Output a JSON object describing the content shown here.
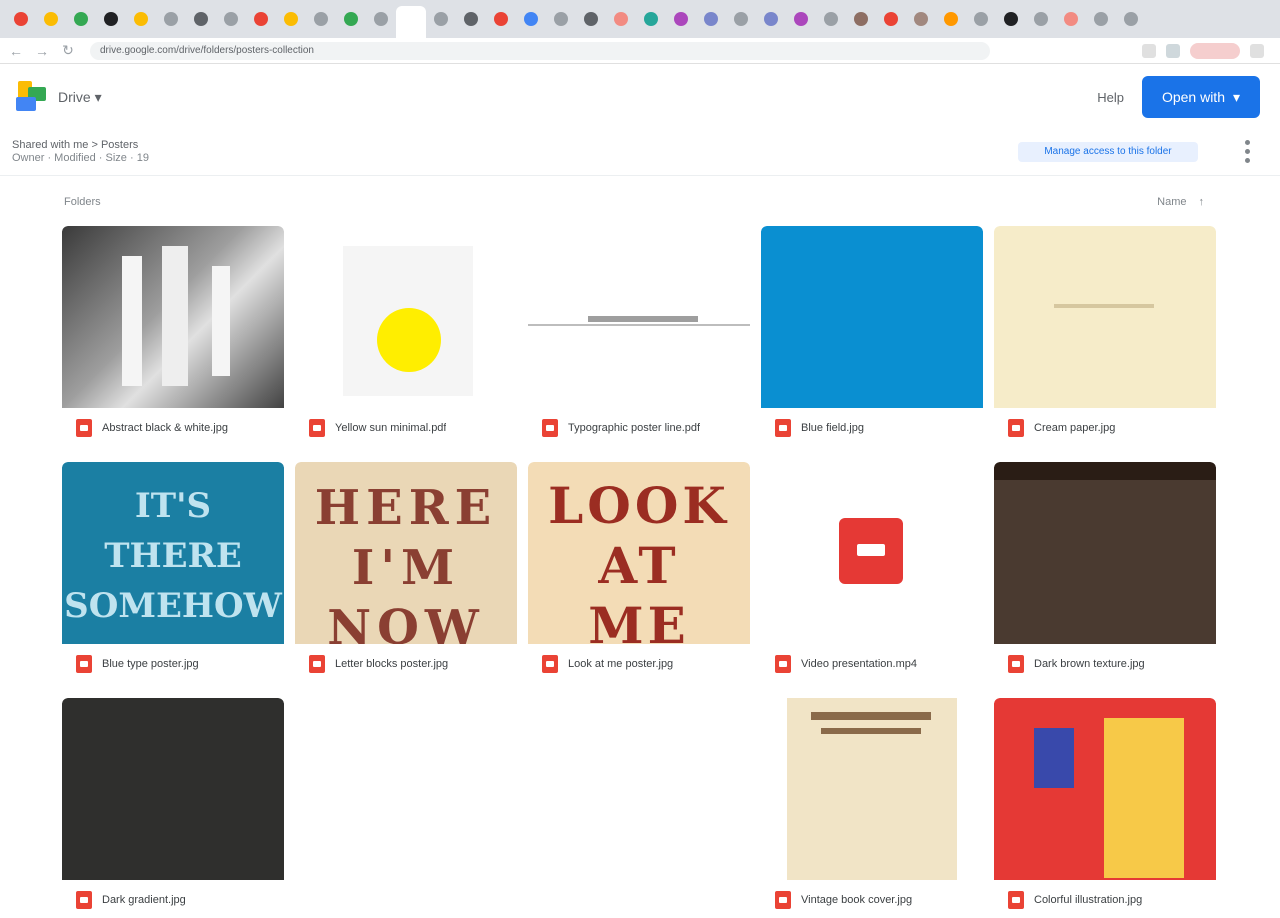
{
  "browser": {
    "tabs": [
      {
        "color": "#ea4335"
      },
      {
        "color": "#fbbc04"
      },
      {
        "color": "#34a853"
      },
      {
        "color": "#202124"
      },
      {
        "color": "#fbbc04"
      },
      {
        "color": "#9aa0a6"
      },
      {
        "color": "#5f6368"
      },
      {
        "color": "#9aa0a6"
      },
      {
        "color": "#ea4335"
      },
      {
        "color": "#fbbc04"
      },
      {
        "color": "#9aa0a6"
      },
      {
        "color": "#34a853"
      },
      {
        "color": "#9aa0a6"
      },
      {
        "color": "#ffffff"
      },
      {
        "color": "#9aa0a6"
      },
      {
        "color": "#5f6368"
      },
      {
        "color": "#ea4335"
      },
      {
        "color": "#4285f4"
      },
      {
        "color": "#9aa0a6"
      },
      {
        "color": "#5f6368"
      },
      {
        "color": "#f28b82"
      },
      {
        "color": "#26a69a"
      },
      {
        "color": "#ab47bc"
      },
      {
        "color": "#7986cb"
      },
      {
        "color": "#9aa0a6"
      },
      {
        "color": "#7986cb"
      },
      {
        "color": "#ab47bc"
      },
      {
        "color": "#9aa0a6"
      },
      {
        "color": "#8d6e63"
      },
      {
        "color": "#ea4335"
      },
      {
        "color": "#a1887f"
      },
      {
        "color": "#ff9800"
      },
      {
        "color": "#9aa0a6"
      },
      {
        "color": "#202124"
      },
      {
        "color": "#9aa0a6"
      },
      {
        "color": "#f28b82"
      },
      {
        "color": "#9aa0a6"
      },
      {
        "color": "#9aa0a6"
      }
    ],
    "url": "drive.google.com/drive/folders/posters-collection"
  },
  "header": {
    "brand": "Drive",
    "help_label": "Help",
    "primary_button": "Open with"
  },
  "subheader": {
    "title": "Shared with me > Posters",
    "subtitle": "Owner · Modified · Size · 19"
  },
  "info_link": "Manage access to this folder",
  "section": {
    "title": "Folders",
    "sort_label": "Name"
  },
  "files": [
    {
      "name": "Abstract black & white.jpg",
      "kind": "bw"
    },
    {
      "name": "Yellow sun minimal.pdf",
      "kind": "sun"
    },
    {
      "name": "Typographic poster line.pdf",
      "kind": "line"
    },
    {
      "name": "Blue field.jpg",
      "kind": "blue"
    },
    {
      "name": "Cream paper.jpg",
      "kind": "cream"
    },
    {
      "name": "Blue type poster.jpg",
      "kind": "blueposter",
      "text": [
        "IT'S",
        "THERE",
        "SOMEHOW"
      ]
    },
    {
      "name": "Letter blocks poster.jpg",
      "kind": "blocks",
      "text": [
        "HERE",
        "I'M",
        "NOW"
      ]
    },
    {
      "name": "Look at me poster.jpg",
      "kind": "look",
      "text": [
        "LOOK",
        "AT",
        "ME"
      ]
    },
    {
      "name": "Video presentation.mp4",
      "kind": "video"
    },
    {
      "name": "Dark brown texture.jpg",
      "kind": "brown"
    },
    {
      "name": "Dark gradient.jpg",
      "kind": "dark"
    },
    {
      "name": "",
      "kind": "empty"
    },
    {
      "name": "",
      "kind": "empty"
    },
    {
      "name": "Vintage book cover.jpg",
      "kind": "vintage"
    },
    {
      "name": "Colorful illustration.jpg",
      "kind": "illus"
    }
  ]
}
